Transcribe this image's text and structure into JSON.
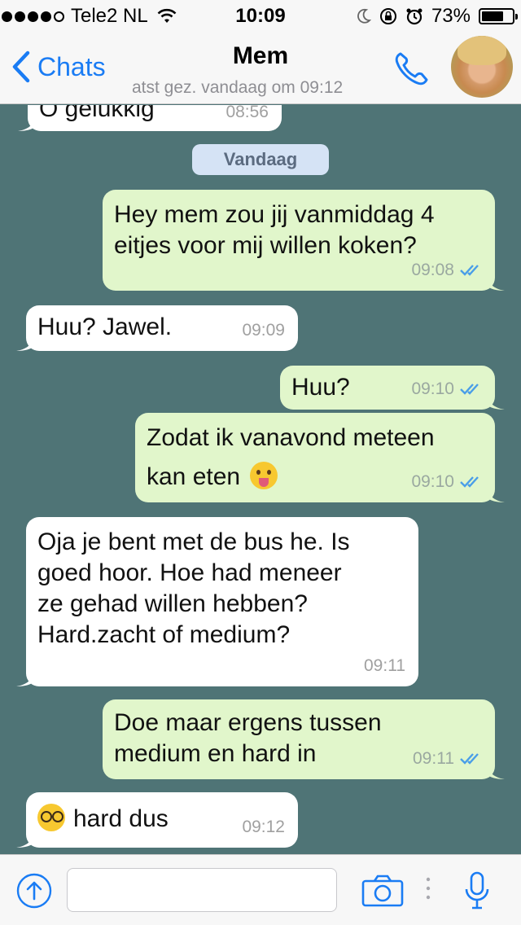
{
  "status_bar": {
    "carrier": "Tele2 NL",
    "time": "10:09",
    "battery": "73%",
    "battery_fraction": 0.73
  },
  "nav": {
    "back_label": "Chats",
    "contact_name": "Mem",
    "last_seen": "atst gez. vandaag om 09:12"
  },
  "date_chip": "Vandaag",
  "messages": [
    {
      "dir": "in",
      "text": "O gelukkig",
      "time": "08:56"
    },
    {
      "dir": "out",
      "text_lines": [
        "Hey mem zou jij vanmiddag 4",
        "eitjes voor mij willen koken?"
      ],
      "time": "09:08",
      "ticks": "read"
    },
    {
      "dir": "in",
      "text": "Huu? Jawel.",
      "time": "09:09"
    },
    {
      "dir": "out",
      "text": "Huu?",
      "time": "09:10",
      "ticks": "read"
    },
    {
      "dir": "out",
      "text_lines": [
        "Zodat ik vanavond meteen",
        "kan eten"
      ],
      "emoji": "tongue-face",
      "time": "09:10",
      "ticks": "read"
    },
    {
      "dir": "in",
      "text_lines": [
        "Oja je bent met de bus he. Is",
        "goed hoor. Hoe had meneer",
        "ze gehad willen hebben?",
        "Hard.zacht of medium?"
      ],
      "time": "09:11"
    },
    {
      "dir": "out",
      "text_lines": [
        "Doe maar ergens tussen",
        "medium en hard in"
      ],
      "time": "09:11",
      "ticks": "read"
    },
    {
      "dir": "in",
      "text": "hard dus",
      "emoji": "nerd-face",
      "time": "09:12"
    }
  ],
  "input": {
    "placeholder": ""
  },
  "colors": {
    "chat_background": "#4f7476",
    "incoming_bubble": "#ffffff",
    "outgoing_bubble": "#e1f6cb",
    "accent": "#1a7cf4",
    "read_ticks": "#4a9ee8"
  }
}
